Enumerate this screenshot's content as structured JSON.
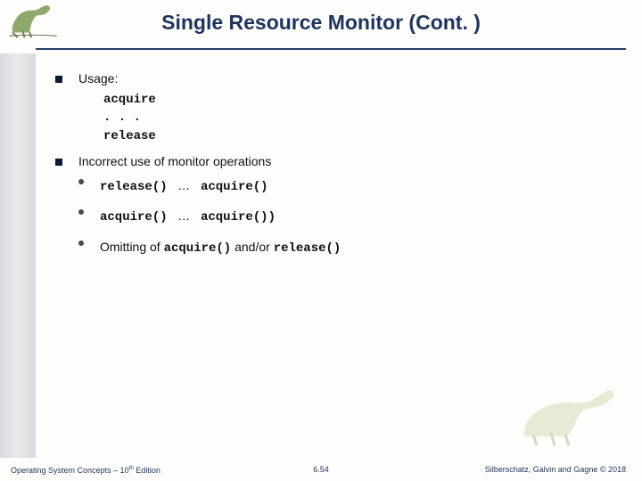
{
  "slide": {
    "title": "Single Resource Monitor (Cont. )",
    "bullets": {
      "usage_label": "Usage:",
      "code": {
        "l1": "acquire",
        "l2": ". . .",
        "l3": "release"
      },
      "incorrect_label": "Incorrect use of monitor operations",
      "sub": {
        "s1_a": "release()",
        "s1_mid": "…",
        "s1_b": "acquire()",
        "s2_a": "acquire()",
        "s2_mid": "…",
        "s2_b": "acquire())",
        "s3_pre": "Omitting  of ",
        "s3_c1": "acquire()",
        "s3_mid": " and/or ",
        "s3_c2": "release()"
      }
    }
  },
  "footer": {
    "left_pre": "Operating System Concepts – 10",
    "left_sup": "th",
    "left_post": " Edition",
    "center": "6.54",
    "right": "Silberschatz, Galvin and Gagne © 2018"
  }
}
